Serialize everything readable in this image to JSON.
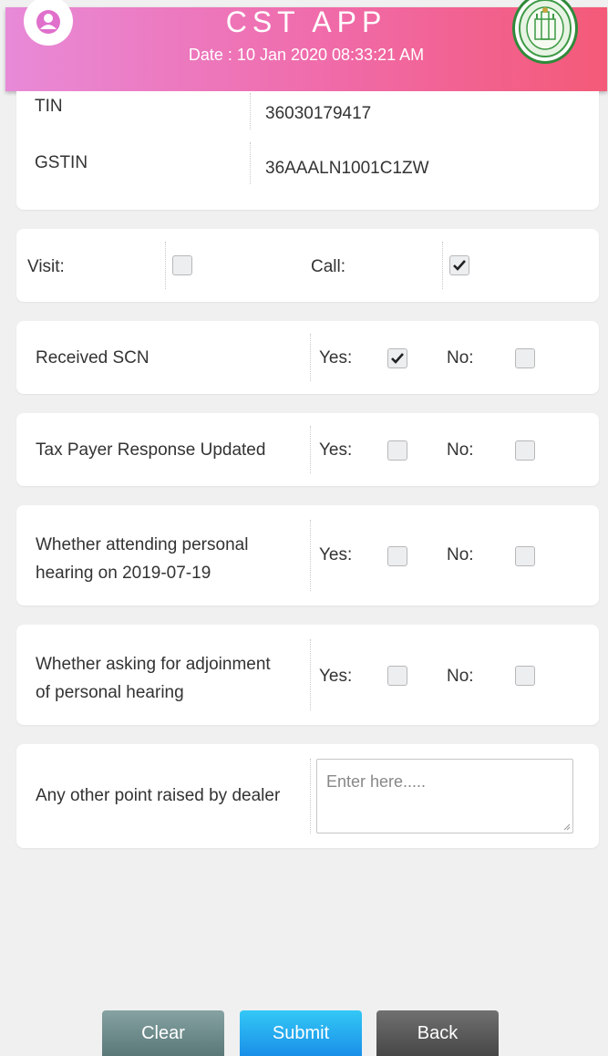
{
  "header": {
    "title": "CST APP",
    "date": "Date : 10 Jan 2020 08:33:21 AM"
  },
  "dealer_info": {
    "tin_label": "TIN",
    "tin_value": "36030179417",
    "gstin_label": "GSTIN",
    "gstin_value": "36AAALN1001C1ZW"
  },
  "contact_mode": {
    "visit_label": "Visit:",
    "visit_checked": false,
    "call_label": "Call:",
    "call_checked": true
  },
  "questions": [
    {
      "label": "Received SCN",
      "yes_label": "Yes:",
      "no_label": "No:",
      "yes_checked": true,
      "no_checked": false
    },
    {
      "label": "Tax Payer Response Updated",
      "yes_label": "Yes:",
      "no_label": "No:",
      "yes_checked": false,
      "no_checked": false
    },
    {
      "label_line1": "Whether attending personal",
      "label_line2": "hearing on 2019-07-19",
      "yes_label": "Yes:",
      "no_label": "No:",
      "yes_checked": false,
      "no_checked": false
    },
    {
      "label_line1": "Whether asking for adjoinment",
      "label_line2": "of personal hearing",
      "yes_label": "Yes:",
      "no_label": "No:",
      "yes_checked": false,
      "no_checked": false
    }
  ],
  "other_points": {
    "label": "Any other point raised by dealer",
    "value": "",
    "placeholder": "Enter here....."
  },
  "buttons": {
    "clear": "Clear",
    "submit": "Submit",
    "back": "Back"
  },
  "colors": {
    "header_gradient_start": "#e88ad8",
    "header_gradient_end": "#f45a78",
    "submit_button": "#1a8fe8",
    "clear_button": "#5a7878",
    "back_button": "#474747"
  },
  "icons": {
    "avatar": "user-avatar-icon",
    "emblem": "state-emblem-logo",
    "check": "check-icon"
  }
}
